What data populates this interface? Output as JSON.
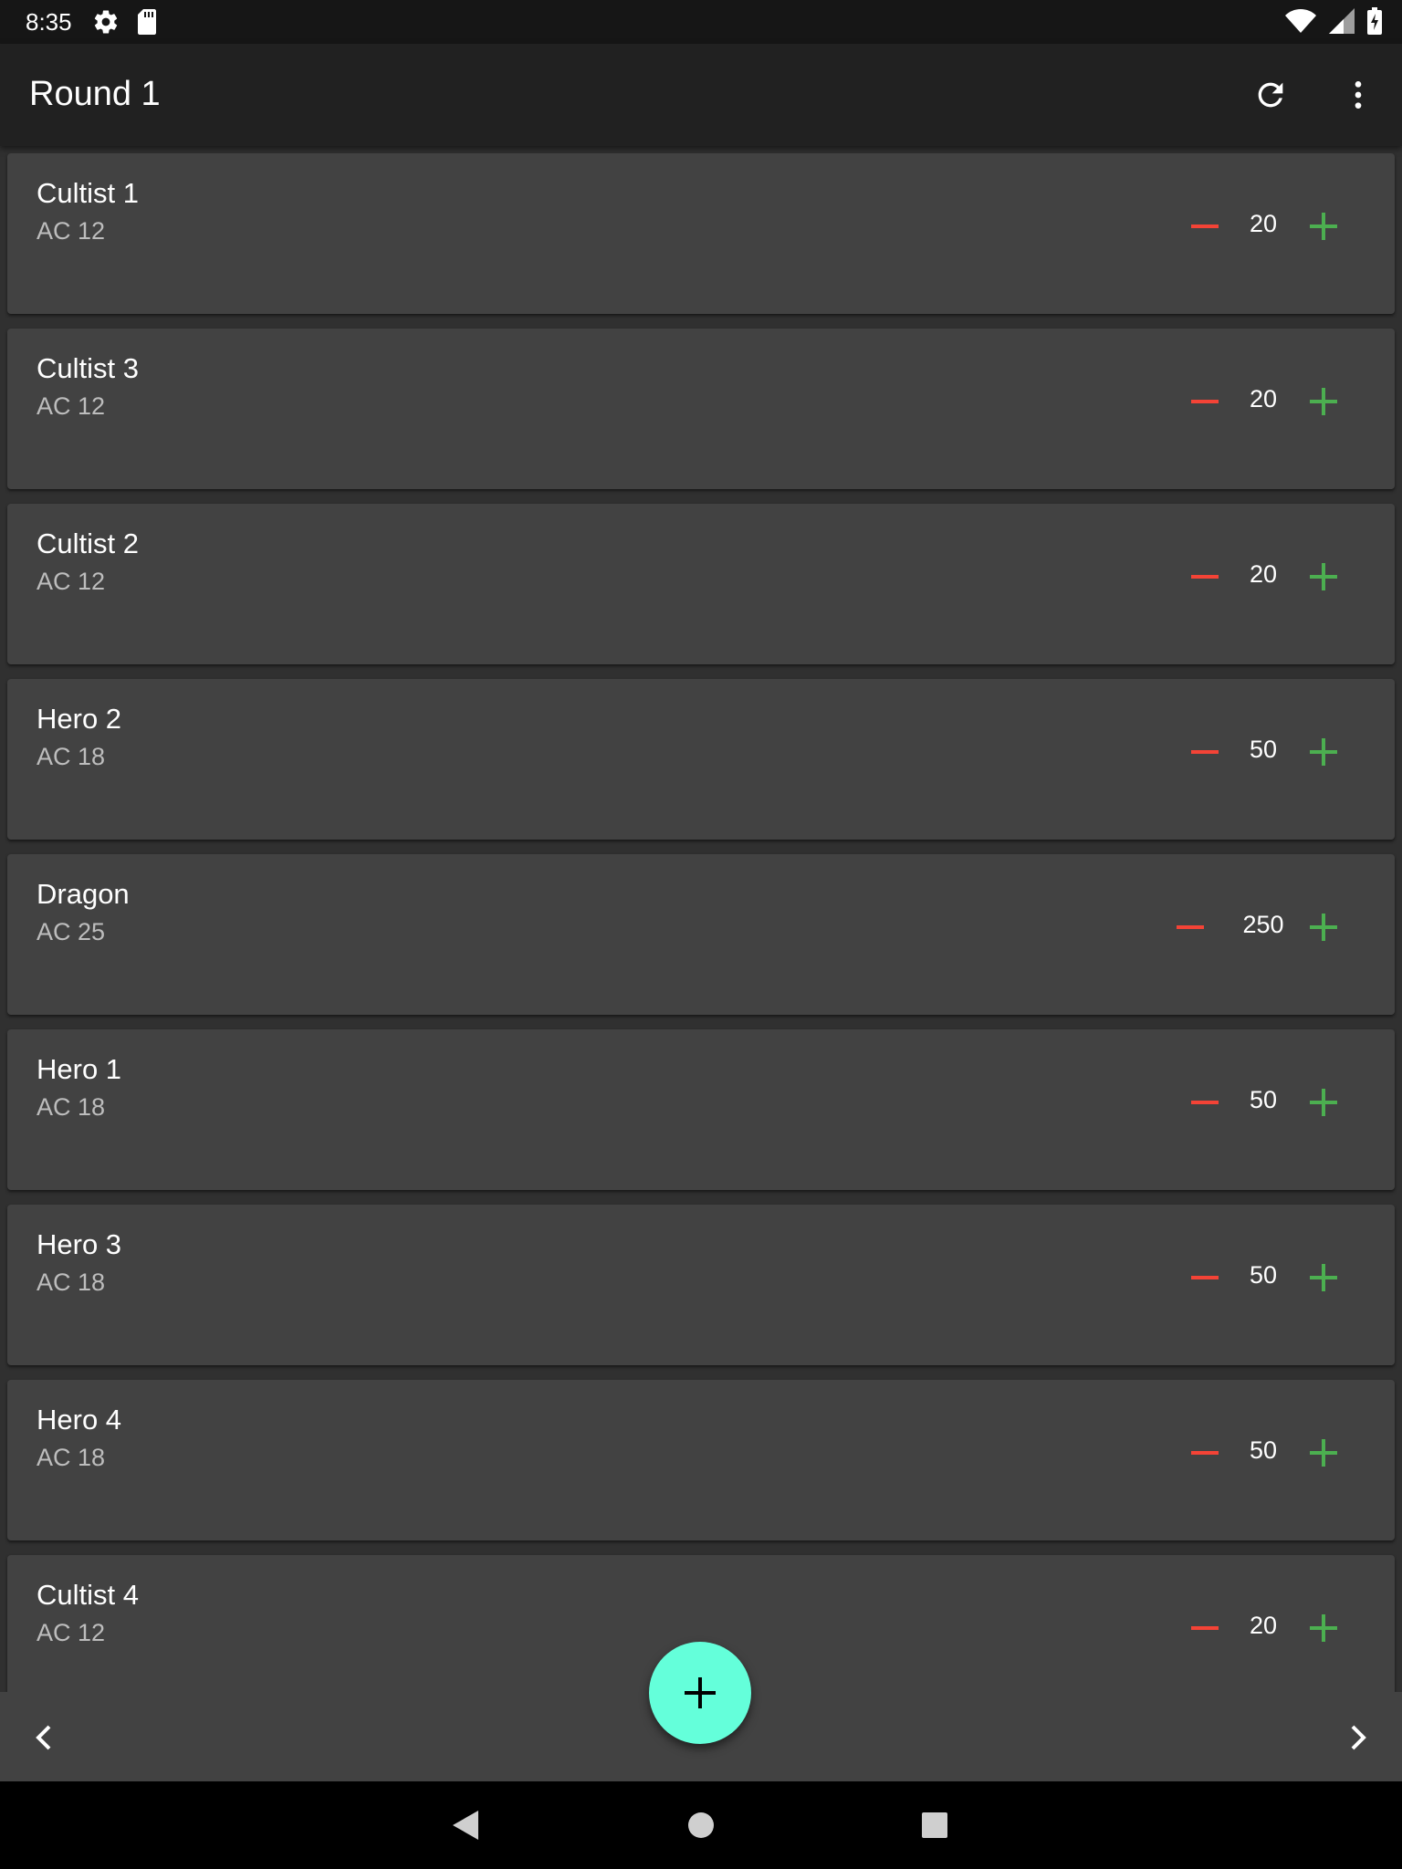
{
  "status_bar": {
    "time": "8:35"
  },
  "app_bar": {
    "title": "Round 1"
  },
  "combatants": [
    {
      "name": "Cultist 1",
      "ac": "AC 12",
      "hp": "20"
    },
    {
      "name": "Cultist 3",
      "ac": "AC 12",
      "hp": "20"
    },
    {
      "name": "Cultist 2",
      "ac": "AC 12",
      "hp": "20"
    },
    {
      "name": "Hero 2",
      "ac": "AC 18",
      "hp": "50"
    },
    {
      "name": "Dragon",
      "ac": "AC 25",
      "hp": "250"
    },
    {
      "name": "Hero 1",
      "ac": "AC 18",
      "hp": "50"
    },
    {
      "name": "Hero 3",
      "ac": "AC 18",
      "hp": "50"
    },
    {
      "name": "Hero 4",
      "ac": "AC 18",
      "hp": "50"
    },
    {
      "name": "Cultist 4",
      "ac": "AC 12",
      "hp": "20"
    }
  ],
  "colors": {
    "minus": "#f44336",
    "plus": "#4caf50",
    "fab": "#64ffda"
  }
}
